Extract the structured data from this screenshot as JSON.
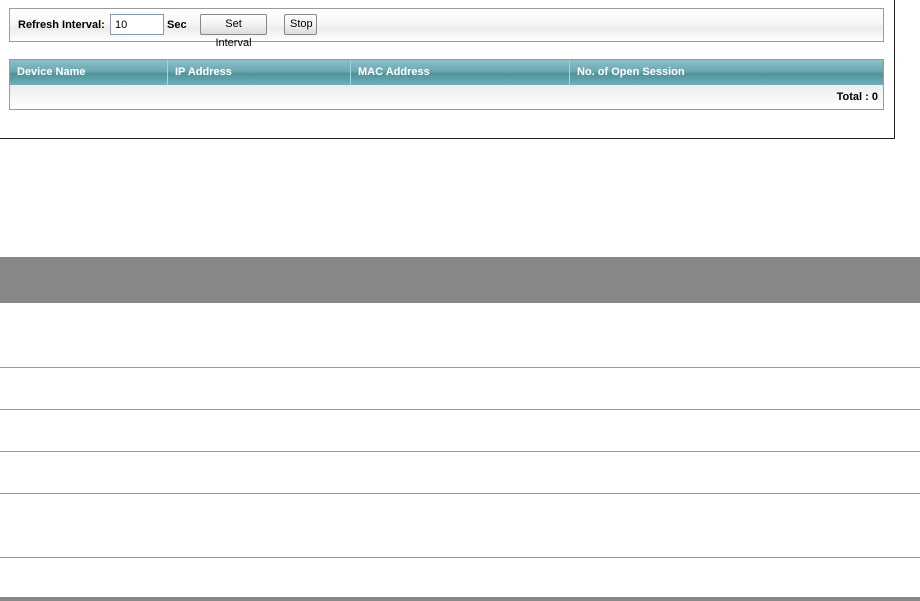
{
  "refresh": {
    "label": "Refresh Interval:",
    "value": "10",
    "unit": "Sec",
    "set_button": "Set Interval",
    "stop_button": "Stop"
  },
  "table": {
    "columns": [
      "Device Name",
      "IP Address",
      "MAC Address",
      "No. of Open Session"
    ],
    "rows": [],
    "total_label": "Total : 0"
  },
  "colors": {
    "header_teal": "#5f9ea6",
    "doc_header_gray": "#888888"
  }
}
